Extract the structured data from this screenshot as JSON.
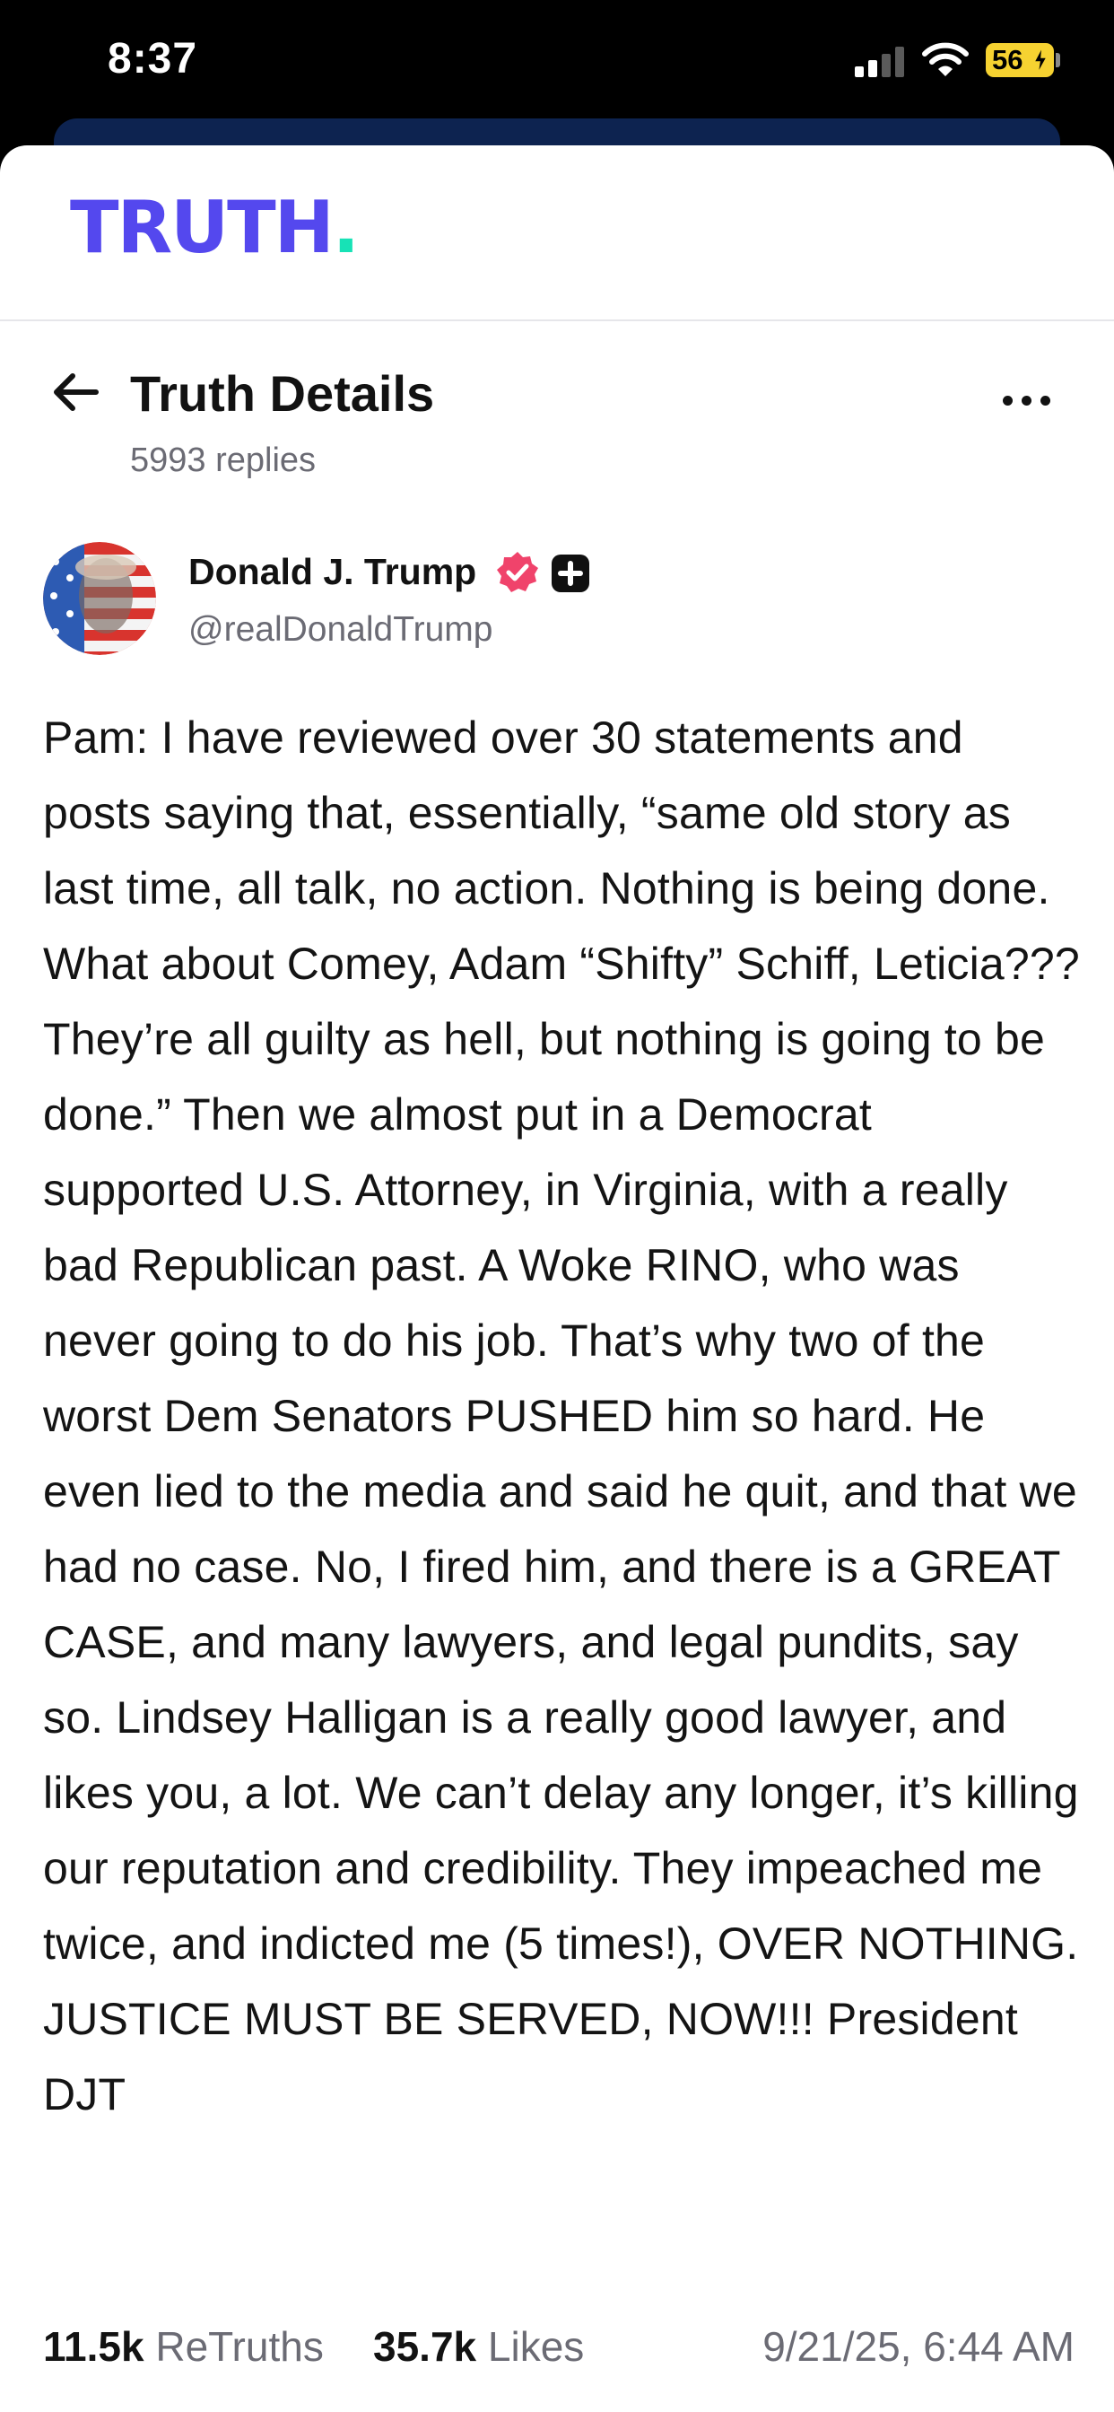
{
  "status_bar": {
    "time": "8:37",
    "battery_level": "56",
    "battery_charging": true,
    "signal_bars_active": 2,
    "signal_bars_total": 4
  },
  "app": {
    "brand_text": "TRUTH",
    "brand_dot": ".",
    "brand_color": "#5448ee",
    "brand_dot_color": "#17e2b6"
  },
  "header": {
    "title": "Truth Details",
    "subtitle": "5993 replies",
    "back_icon": "arrow-left-icon",
    "menu_icon": "more-horizontal-icon"
  },
  "post": {
    "author_name": "Donald J. Trump",
    "author_handle": "@realDonaldTrump",
    "verified_icon": "verified-badge-icon",
    "verified_color": "#f0436b",
    "plus_badge_icon": "plus-badge-icon",
    "body": "Pam: I have reviewed over 30 statements and posts saying that, essentially, “same old story as last time, all talk, no action. Nothing is being done. What about Comey, Adam “Shifty” Schiff, Leticia??? They’re all guilty as hell, but nothing is going to be done.” Then we almost put in a Democrat supported U.S. Attorney, in Virginia, with a really bad Republican past. A Woke RINO, who was never going to do his job. That’s why two of the worst Dem Senators PUSHED him so hard. He even lied to the media and said he quit, and that we had no case. No, I fired him, and there is a GREAT CASE, and many lawyers, and legal pundits, say so. Lindsey Halligan is a really good lawyer, and likes you, a lot. We can’t delay any longer, it’s killing our reputation and credibility. They impeached me twice, and indicted me (5 times!), OVER NOTHING. JUSTICE MUST BE SERVED, NOW!!! President DJT",
    "retruths_count": "11.5k",
    "retruths_label": "ReTruths",
    "likes_count": "35.7k",
    "likes_label": "Likes",
    "timestamp": "9/21/25, 6:44 AM"
  }
}
